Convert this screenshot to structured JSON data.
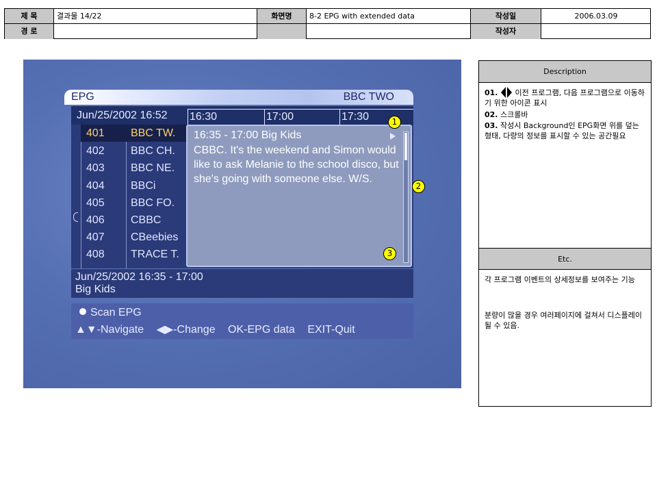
{
  "header": {
    "row1": [
      {
        "label": "제  목",
        "value": "결과물 14/22"
      },
      {
        "label": "화면명",
        "value": "8-2 EPG with extended data"
      },
      {
        "label": "작성일",
        "value": "2006.03.09"
      }
    ],
    "row2": [
      {
        "label": "경  로",
        "value": ""
      },
      {
        "label": "",
        "value": ""
      },
      {
        "label": "작성자",
        "value": ""
      }
    ]
  },
  "tv": {
    "title": "EPG",
    "channel": "BBC TWO",
    "date": "Jun/25/2002 16:52",
    "times": [
      "16:30",
      "17:00",
      "17:30"
    ],
    "channels": [
      {
        "num": "401",
        "name": "BBC TW.",
        "selected": true
      },
      {
        "num": "402",
        "name": "BBC CH."
      },
      {
        "num": "403",
        "name": "BBC NE."
      },
      {
        "num": "404",
        "name": "BBCi"
      },
      {
        "num": "405",
        "name": "BBC FO."
      },
      {
        "num": "406",
        "name": "CBBC"
      },
      {
        "num": "407",
        "name": "CBeebies"
      },
      {
        "num": "408",
        "name": "TRACE T."
      }
    ],
    "detail": {
      "heading": "16:35 - 17:00  Big Kids",
      "body": "CBBC. It's the weekend and Simon would like to ask Melanie to the school disco, but she's going with someone else. W/S."
    },
    "info": {
      "line1": "Jun/25/2002 16:35 - 17:00",
      "line2": "Big Kids"
    },
    "footer": {
      "scan": "Scan EPG",
      "navigate": "▲▼-Navigate",
      "change": "◀▶-Change",
      "ok": "OK-EPG data",
      "exit": "EXIT-Quit"
    },
    "badges": [
      "1",
      "2",
      "3"
    ],
    "accent_colors": {
      "selected_text": "#ffd36a",
      "badge": "#ffff00"
    }
  },
  "panel": {
    "description_title": "Description",
    "items": [
      {
        "num": "01.",
        "text": "이전 프로그램, 다음 프로그램으로 이동하기 위한 아이콘 표시"
      },
      {
        "num": "02.",
        "text": "스크롤바"
      },
      {
        "num": "03.",
        "text": "작성시 Background인 EPG화면 위를 덮는 형태, 다량의 정보를 표시할 수 있는 공간필요"
      }
    ],
    "etc_title": "Etc.",
    "etc_text1": "각 프로그램 이벤트의 상세정보를 보여주는 기능",
    "etc_text2": "분량이 많을 경우 여러페이지에 걸쳐서 디스플레이 될 수 있음."
  }
}
